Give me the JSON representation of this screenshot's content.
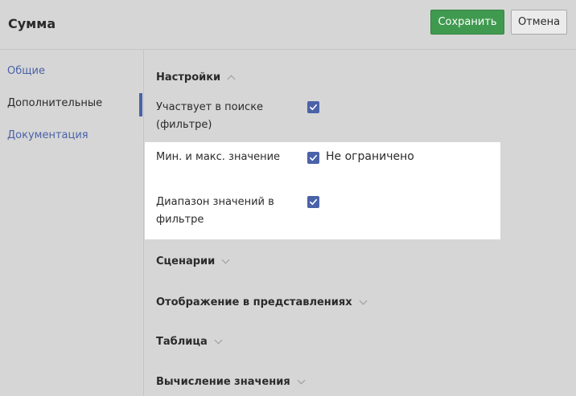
{
  "header": {
    "title": "Сумма",
    "save_label": "Сохранить",
    "cancel_label": "Отмена"
  },
  "sidebar": {
    "items": [
      {
        "label": "Общие",
        "active": false
      },
      {
        "label": "Дополнительные",
        "active": true
      },
      {
        "label": "Документация",
        "active": false
      }
    ]
  },
  "settings": {
    "title": "Настройки",
    "expanded": true,
    "rows": [
      {
        "label_line1": "Участвует в поиске",
        "label_line2": "(фильтре)",
        "checked": true
      },
      {
        "label_line1": "Мин. и макс. значение",
        "checked": true,
        "checkbox_text": "Не ограничено"
      },
      {
        "label_line1": "Диапазон значений в",
        "label_line2": "фильтре",
        "checked": true
      }
    ]
  },
  "sections": [
    {
      "title": "Сценарии",
      "expanded": false
    },
    {
      "title": "Отображение в представлениях",
      "expanded": false
    },
    {
      "title": "Таблица",
      "expanded": false
    },
    {
      "title": "Вычисление значения",
      "expanded": false
    }
  ],
  "colors": {
    "accent": "#4a62a8",
    "save_button": "#3f9a4f",
    "background": "#d6d6d6",
    "highlight": "#ffffff"
  },
  "icons": {
    "checkbox": "checkmark-icon",
    "expand": "chevron-down-icon",
    "collapse": "chevron-up-icon"
  }
}
